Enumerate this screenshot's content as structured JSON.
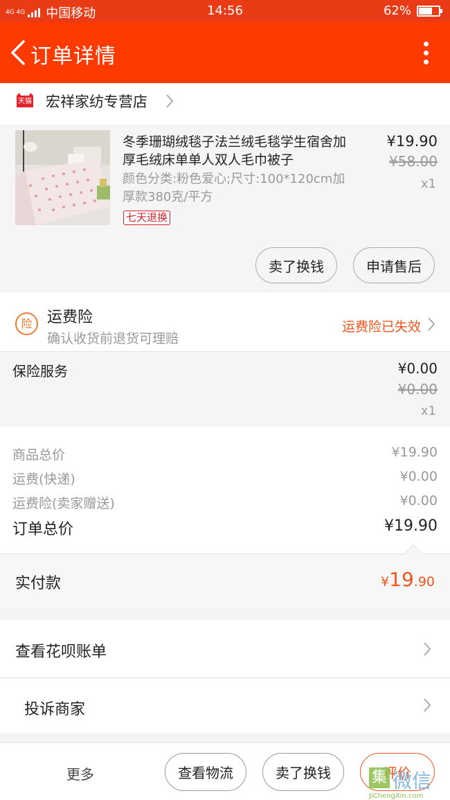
{
  "status_bar": {
    "network": "4G 4G",
    "carrier": "中国移动",
    "time": "14:56",
    "battery_text": "62%",
    "battery_level": 0.62
  },
  "nav": {
    "title": "订单详情"
  },
  "store": {
    "badge": "天猫",
    "name": "宏祥家纺专营店"
  },
  "product": {
    "title": "冬季珊瑚绒毯子法兰绒毛毯学生宿舍加厚毛绒床单单人双人毛巾被子",
    "spec": "颜色分类:粉色爱心;尺寸:100*120cm加厚款380克/平方",
    "badge": "七天退换",
    "price": "¥19.90",
    "original_price": "¥58.00",
    "quantity": "x1",
    "actions": [
      "卖了换钱",
      "申请售后"
    ]
  },
  "freight_insurance": {
    "icon_char": "险",
    "title": "运费险",
    "subtitle": "确认收货前退货可理赔",
    "status": "运费险已失效"
  },
  "insurance_service": {
    "label": "保险服务",
    "price": "¥0.00",
    "original_price": "¥0.00",
    "quantity": "x1"
  },
  "summary": {
    "rows": [
      {
        "label": "商品总价",
        "value": "¥19.90"
      },
      {
        "label": "运费(快递)",
        "value": "¥0.00"
      },
      {
        "label": "运费险(卖家赠送)",
        "value": "¥0.00"
      }
    ],
    "total_label": "订单总价",
    "total_value": "¥19.90"
  },
  "paid": {
    "label": "实付款",
    "symbol": "¥",
    "integer": "19",
    "decimal": ".90"
  },
  "links": {
    "huabei": "查看花呗账单",
    "complain": "投诉商家"
  },
  "bottom_bar": {
    "more": "更多",
    "buttons": [
      "查看物流",
      "卖了换钱",
      "评价"
    ]
  },
  "watermark": {
    "char": "集",
    "text": "微信",
    "url_text": "JiChengXin.com"
  },
  "colors": {
    "brand_red": "#ff3a00",
    "accent_orange": "#f0561f",
    "tmall_red": "#e2232b"
  }
}
